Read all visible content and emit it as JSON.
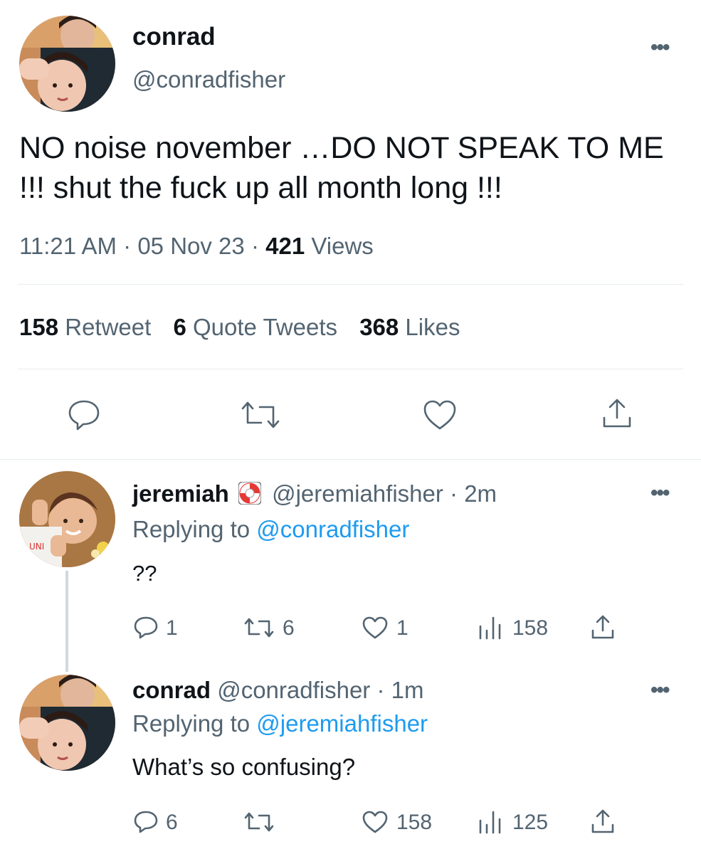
{
  "main_tweet": {
    "author_name": "conrad",
    "handle": "@conradfisher",
    "text": "NO noise november …DO NOT SPEAK TO ME !!! shut the fuck up all month long !!!",
    "time": "11:21 AM",
    "date": "05 Nov 23",
    "views_count": "421",
    "views_label": "Views",
    "retweets_count": "158",
    "retweets_label": "Retweet",
    "quotes_count": "6",
    "quotes_label": "Quote Tweets",
    "likes_count": "368",
    "likes_label": "Likes"
  },
  "replies": [
    {
      "author_name": "jeremiah",
      "badge_icon": "lifebuoy-emoji",
      "handle": "@jeremiahfisher",
      "age": "2m",
      "replying_prefix": "Replying to",
      "replying_to": "@conradfisher",
      "text": "??",
      "reply_count": "1",
      "retweet_count": "6",
      "like_count": "1",
      "view_count": "158"
    },
    {
      "author_name": "conrad",
      "handle": "@conradfisher",
      "age": "1m",
      "replying_prefix": "Replying to",
      "replying_to": "@jeremiahfisher",
      "text": "What’s so confusing?",
      "reply_count": "6",
      "retweet_count": "",
      "like_count": "158",
      "view_count": "125"
    }
  ],
  "colors": {
    "text": "#0f1419",
    "muted": "#536471",
    "link": "#1d9bf0",
    "divider": "#e6ecf0"
  },
  "separator": "·",
  "more_dots": "•••"
}
